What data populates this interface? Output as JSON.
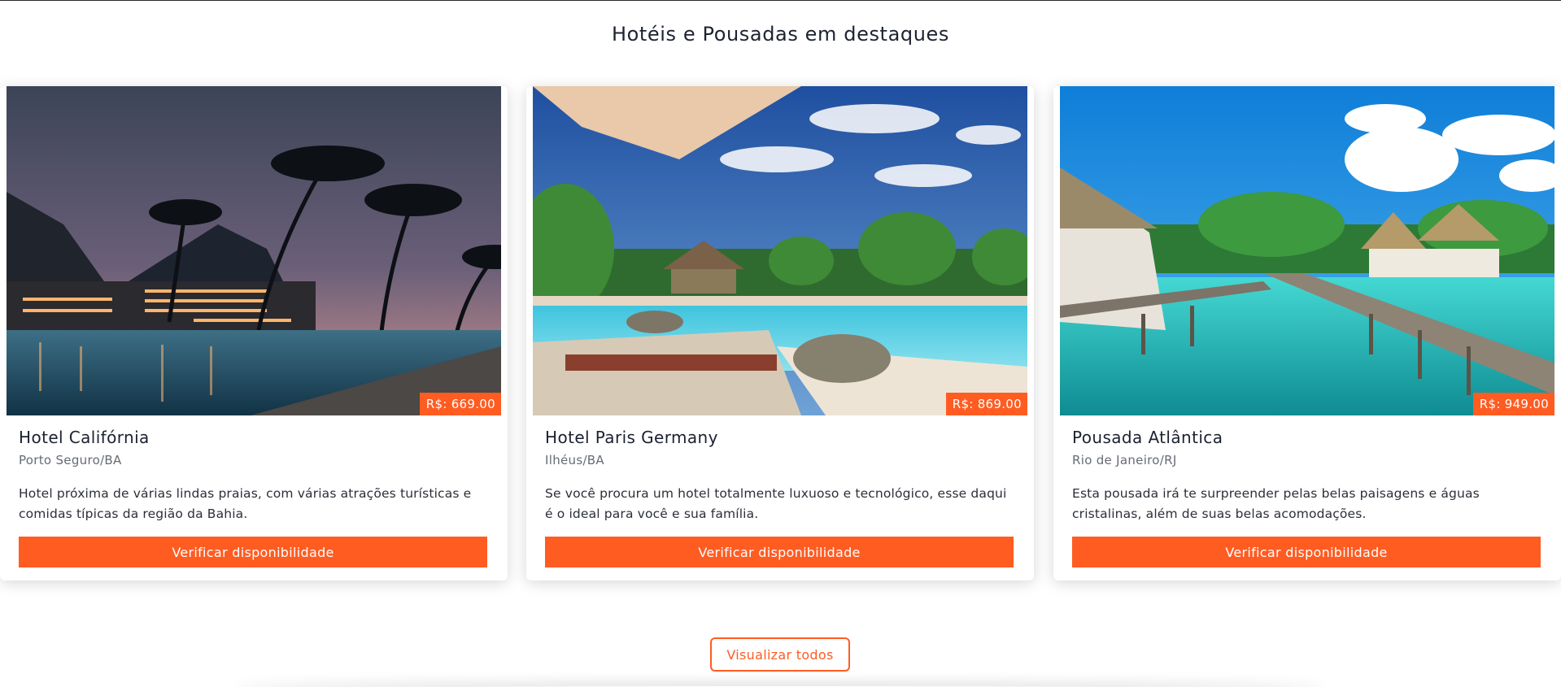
{
  "section": {
    "title": "Hotéis e Pousadas em destaques"
  },
  "hotels": [
    {
      "name": "Hotel Califórnia",
      "location": "Porto Seguro/BA",
      "price": "R$: 669.00",
      "description": "Hotel próxima de várias lindas praias, com várias atrações turísticas e comidas típicas da região da Bahia.",
      "button_label": "Verificar disponibilidade"
    },
    {
      "name": "Hotel Paris Germany",
      "location": "Ilhéus/BA",
      "price": "R$: 869.00",
      "description": "Se você procura um hotel totalmente luxuoso e tecnológico, esse daqui é o ideal para você e sua família.",
      "button_label": "Verificar disponibilidade"
    },
    {
      "name": "Pousada Atlântica",
      "location": "Rio de Janeiro/RJ",
      "price": "R$: 949.00",
      "description": "Esta pousada irá te surpreender pelas belas paisagens e águas cristalinas, além de suas belas acomodações.",
      "button_label": "Verificar disponibilidade"
    }
  ],
  "view_all": {
    "label": "Visualizar todos"
  },
  "colors": {
    "accent": "#ff5c22",
    "title": "#1d2330",
    "muted": "#666b74"
  },
  "icons": {
    "photo_1": "hotel-night-pool-photo",
    "photo_2": "resort-pool-umbrella-photo",
    "photo_3": "overwater-bungalow-photo"
  }
}
